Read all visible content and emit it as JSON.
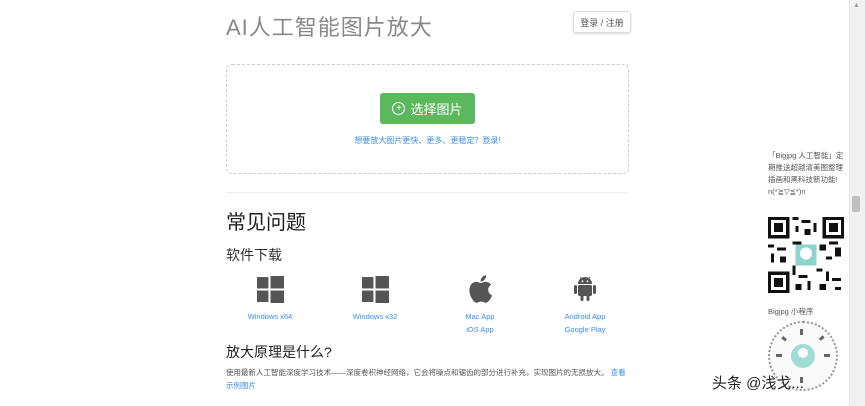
{
  "header": {
    "title": "AI人工智能图片放大",
    "login_label": "登录 / 注册"
  },
  "upload": {
    "button_label": "选择图片",
    "hint": "想要放大图片更快、更多、更稳定？登录!"
  },
  "faq": {
    "heading": "常见问题",
    "download_heading": "软件下载",
    "downloads": [
      {
        "icon": "windows-icon",
        "links": [
          "Windows x64"
        ]
      },
      {
        "icon": "windows-icon",
        "links": [
          "Windows x32"
        ]
      },
      {
        "icon": "apple-icon",
        "links": [
          "Mac App",
          "iOS App"
        ]
      },
      {
        "icon": "android-icon",
        "links": [
          "Android App",
          "Google Play"
        ]
      }
    ],
    "principle_heading": "放大原理是什么?",
    "principle_text": "使用最新人工智能深度学习技术——深度卷积神经网络，它会将噪点和锯齿的部分进行补充，实现图片的无损放大。",
    "principle_more": "查看示例图片"
  },
  "sidebar": {
    "promo_text": "「Bigjpg 人工智能」定期推送超越清美图整理插画和黑科技新功能!",
    "emoticon": "n(*≧▽≦*)n",
    "mini_program_label": "Bigjpg 小程序"
  },
  "watermark": "头条 @浅戈..."
}
